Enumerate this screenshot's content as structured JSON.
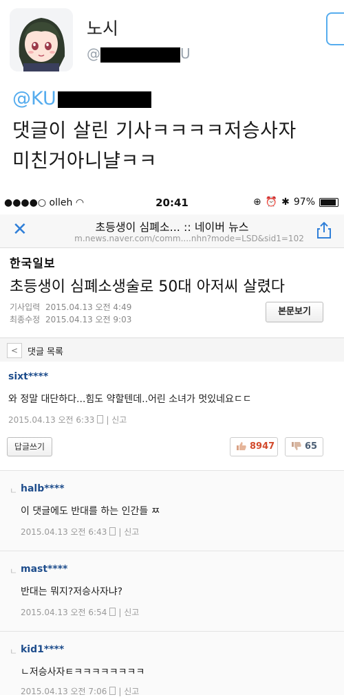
{
  "tweet": {
    "display_name": "노시",
    "handle_prefix": "@",
    "handle_suffix": "U",
    "mention_prefix": "@KU",
    "line1": "댓글이 살린 기사ㅋㅋㅋㅋ저승사자",
    "line2": "미친거아니냘ㅋㅋ"
  },
  "status": {
    "carrier": "●●●●○ olleh",
    "time": "20:41",
    "battery": "97%"
  },
  "nav": {
    "close": "✕",
    "title": "초등생이 심폐소... :: 네이버 뉴스",
    "url": "m.news.naver.com/comm....nhn?mode=LSD&sid1=102"
  },
  "article": {
    "press": "한국일보",
    "headline": "초등생이 심폐소생술로 50대 아저씨 살렸다",
    "input_label": "기사입력",
    "input_date": "2015.04.13 오전 4:49",
    "edit_label": "최종수정",
    "edit_date": "2015.04.13 오전 9:03",
    "full_text_button": "본문보기"
  },
  "comments_bar": {
    "back": "<",
    "label": "댓글 목록"
  },
  "comments": [
    {
      "author": "sixt****",
      "text": "와 정말 대단하다...힘도 약할텐데..어린 소녀가 멋있네요ㄷㄷ",
      "date": "2015.04.13 오전 6:33",
      "report": "신고",
      "reply_button": "답글쓰기",
      "likes": "8947",
      "dislikes": "65"
    },
    {
      "reply_mark": "ㄴ",
      "author": "halb****",
      "text": "이 댓글에도 반대를 하는 인간들 ㅉ",
      "date": "2015.04.13 오전 6:43",
      "report": "신고"
    },
    {
      "reply_mark": "ㄴ",
      "author": "mast****",
      "text": "반대는 뭐지?저승사자냐?",
      "date": "2015.04.13 오전 6:54",
      "report": "신고"
    },
    {
      "reply_mark": "ㄴ",
      "author": "kid1****",
      "text": "ㄴ저승사자ㅌㅋㅋㅋㅋㅋㅋㅋㅋ",
      "date": "2015.04.13 오전 7:06",
      "report": "신고"
    }
  ],
  "colors": {
    "twitter_blue": "#55acee",
    "author_blue": "#1e4d8c",
    "like_red": "#d24a2c",
    "nav_blue": "#2f7fd8"
  },
  "icons": [
    "avatar",
    "wifi-icon",
    "alarm-icon",
    "bluetooth-icon",
    "battery-icon",
    "close-icon",
    "share-icon",
    "back-icon",
    "phone-icon",
    "thumbs-up-icon",
    "thumbs-down-icon"
  ]
}
